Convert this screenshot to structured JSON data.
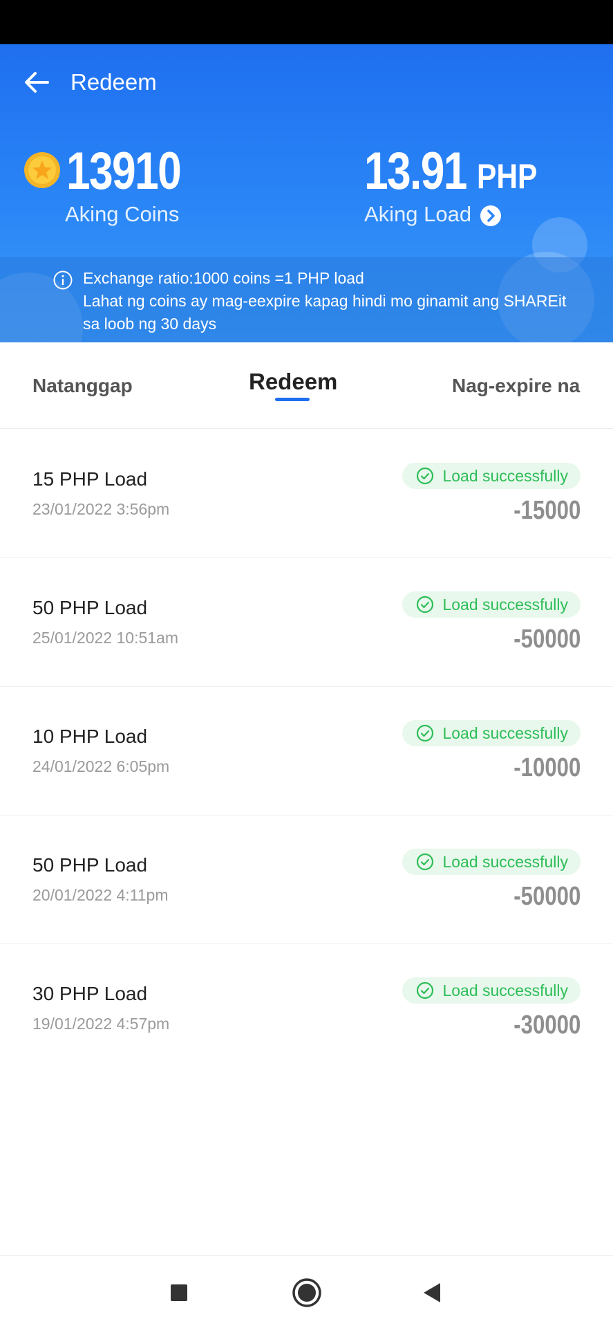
{
  "header": {
    "title": "Redeem",
    "coins_value": "13910",
    "coins_label": "Aking Coins",
    "load_value": "13.91",
    "load_unit": "PHP",
    "load_label": "Aking Load",
    "info_line1": "Exchange ratio:1000 coins =1 PHP load",
    "info_line2": "Lahat ng coins ay mag-eexpire kapag hindi mo ginamit ang SHAREit sa loob ng 30 days"
  },
  "tabs": [
    {
      "label": "Natanggap"
    },
    {
      "label": "Redeem"
    },
    {
      "label": "Nag-expire na"
    }
  ],
  "active_tab": "Redeem",
  "transactions": [
    {
      "title": "15 PHP Load",
      "date": "23/01/2022 3:56pm",
      "status": "Load successfully",
      "amount": "-15000"
    },
    {
      "title": "50 PHP Load",
      "date": "25/01/2022 10:51am",
      "status": "Load successfully",
      "amount": "-50000"
    },
    {
      "title": "10 PHP Load",
      "date": "24/01/2022 6:05pm",
      "status": "Load successfully",
      "amount": "-10000"
    },
    {
      "title": "50 PHP Load",
      "date": "20/01/2022 4:11pm",
      "status": "Load successfully",
      "amount": "-50000"
    },
    {
      "title": "30 PHP Load",
      "date": "19/01/2022 4:57pm",
      "status": "Load successfully",
      "amount": "-30000"
    }
  ],
  "colors": {
    "brand_blue": "#1f6ff0",
    "success_green": "#2dbd58",
    "amount_gray": "#8e8e8e"
  },
  "icons": {
    "back": "back-arrow-icon",
    "coin": "coin-icon",
    "load_detail": "chevron-right-circle-icon",
    "info": "info-icon",
    "status": "check-circle-icon",
    "nav_recents": "square-icon",
    "nav_home": "home-circle-icon",
    "nav_back": "triangle-back-icon"
  }
}
